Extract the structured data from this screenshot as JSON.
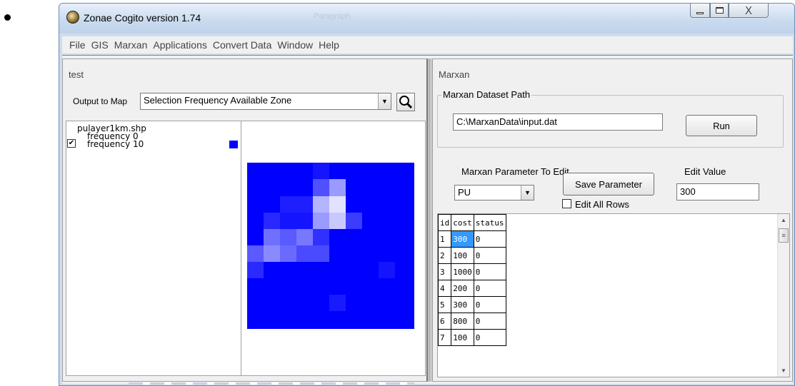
{
  "window": {
    "title": "Zonae Cogito version 1.74",
    "ghost_title": "Paragraph",
    "close_glyph": "X"
  },
  "menu": [
    "File",
    "GIS",
    "Marxan",
    "Applications",
    "Convert Data",
    "Window",
    "Help"
  ],
  "left_panel": {
    "title": "test",
    "output_label": "Output to Map",
    "output_value": "Selection Frequency Available Zone",
    "layer_name": "pulayer1km.shp",
    "legend": [
      {
        "label": "frequency 0",
        "color": ""
      },
      {
        "label": "frequency 10",
        "color": "#0000ff"
      }
    ],
    "map_colors": {
      "base": "#0000ff",
      "light": "#8a8aff",
      "lighter": "#c8c8ff"
    }
  },
  "right_panel": {
    "title": "Marxan",
    "dataset_group_label": "Marxan Dataset Path",
    "dataset_path": "C:\\MarxanData\\input.dat",
    "run_label": "Run",
    "param_label": "Marxan Parameter To Edit",
    "param_value": "PU",
    "save_label": "Save Parameter",
    "edit_value_label": "Edit Value",
    "edit_value": "300",
    "edit_all_label": "Edit All Rows"
  },
  "grid": {
    "headers": [
      "id",
      "cost",
      "status"
    ],
    "rows": [
      [
        "1",
        "300",
        "0"
      ],
      [
        "2",
        "100",
        "0"
      ],
      [
        "3",
        "1000",
        "0"
      ],
      [
        "4",
        "200",
        "0"
      ],
      [
        "5",
        "300",
        "0"
      ],
      [
        "6",
        "800",
        "0"
      ],
      [
        "7",
        "100",
        "0"
      ]
    ]
  }
}
